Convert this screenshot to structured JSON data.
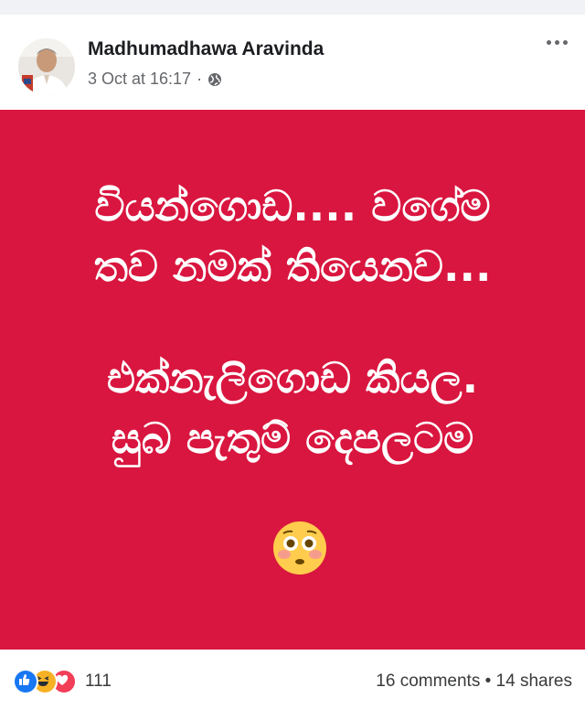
{
  "post": {
    "author": "Madhumadhawa Aravinda",
    "date": "3 Oct at 16:17",
    "separator": "·",
    "privacy_icon": "globe-icon",
    "more_icon": "more-options-icon"
  },
  "image": {
    "background_color": "#d9163f",
    "text_color": "#ffffff",
    "lines": [
      "වියන්ගොඩ.... වගේම",
      "තව නමක් තියෙනව...",
      "එක්නැලිගොඩ කියල.",
      "සුබ පැතුම් දෙපලටම"
    ],
    "emoji": "flushed-face-emoji"
  },
  "footer": {
    "reaction_icons": [
      "like-reaction-icon",
      "haha-reaction-icon",
      "love-reaction-icon"
    ],
    "reaction_count": "111",
    "comments": "16 comments",
    "dot": "•",
    "shares": "14 shares"
  }
}
